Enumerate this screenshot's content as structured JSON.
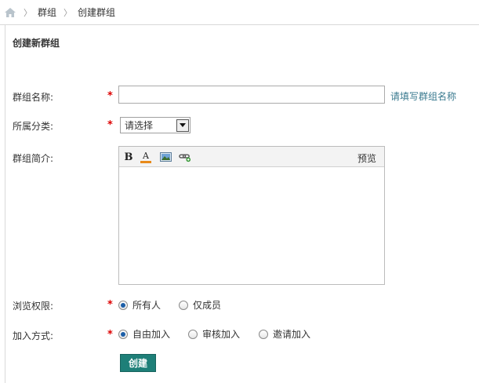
{
  "breadcrumb": {
    "home_icon": "home-icon",
    "items": [
      "群组",
      "创建群组"
    ]
  },
  "form": {
    "title": "创建新群组",
    "required_mark": "*",
    "name": {
      "label": "群组名称:",
      "value": "",
      "hint": "请填写群组名称"
    },
    "category": {
      "label": "所属分类:",
      "selected": "请选择"
    },
    "intro": {
      "label": "群组简介:",
      "toolbar": {
        "icons": [
          "bold-icon",
          "font-color-icon",
          "image-icon",
          "link-icon"
        ],
        "bold_glyph": "B",
        "color_glyph": "A",
        "preview_label": "预览"
      },
      "value": ""
    },
    "browse": {
      "label": "浏览权限:",
      "options": [
        "所有人",
        "仅成员"
      ],
      "selected": "所有人"
    },
    "join": {
      "label": "加入方式:",
      "options": [
        "自由加入",
        "审核加入",
        "邀请加入"
      ],
      "selected": "自由加入"
    },
    "submit_label": "创建"
  },
  "colors": {
    "accent": "#1e7f78",
    "required": "#dd0000",
    "hint": "#3a7a8f",
    "radio_checked": "#1d5fa8"
  }
}
